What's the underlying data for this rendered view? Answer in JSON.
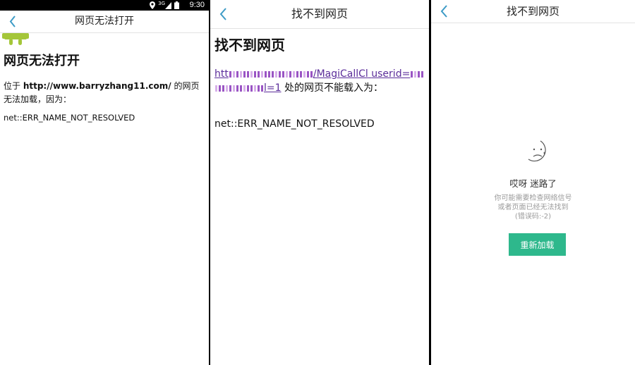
{
  "status_bar": {
    "time": "9:30",
    "network": "3G"
  },
  "panel_1": {
    "nav_title": "网页无法打开",
    "heading": "网页无法打开",
    "message_prefix": "位于 ",
    "url": "http://www.barryzhang11.com/",
    "message_suffix": " 的网页无法加载，因为：",
    "error_code": "net::ERR_NAME_NOT_RESOLVED",
    "logo_icon": "android-logo-icon"
  },
  "panel_2": {
    "nav_title": "找不到网页",
    "heading": "找不到网页",
    "url_head": "htt",
    "url_mid": "/MagiCallCl",
    "url_line2_start": "userid=",
    "url_tail": "l=1",
    "message_suffix": " 处的网页不能载入为：",
    "error_code": "net::ERR_NAME_NOT_RESOLVED"
  },
  "panel_3": {
    "nav_title": "找不到网页",
    "title": "哎呀 迷路了",
    "hint_line1": "你可能需要检查网络信号",
    "hint_line2": "或者页面已经无法找到",
    "hint_line3": "(错误码:-2)",
    "reload_button": "重新加载",
    "icon": "sad-face-icon"
  },
  "colors": {
    "back_arrow": "#3d9bc6",
    "android_green": "#a4c639",
    "reload_button_bg": "#2eb88c",
    "link_purple": "#5b2d9a",
    "status_bar_bg": "#000000"
  }
}
